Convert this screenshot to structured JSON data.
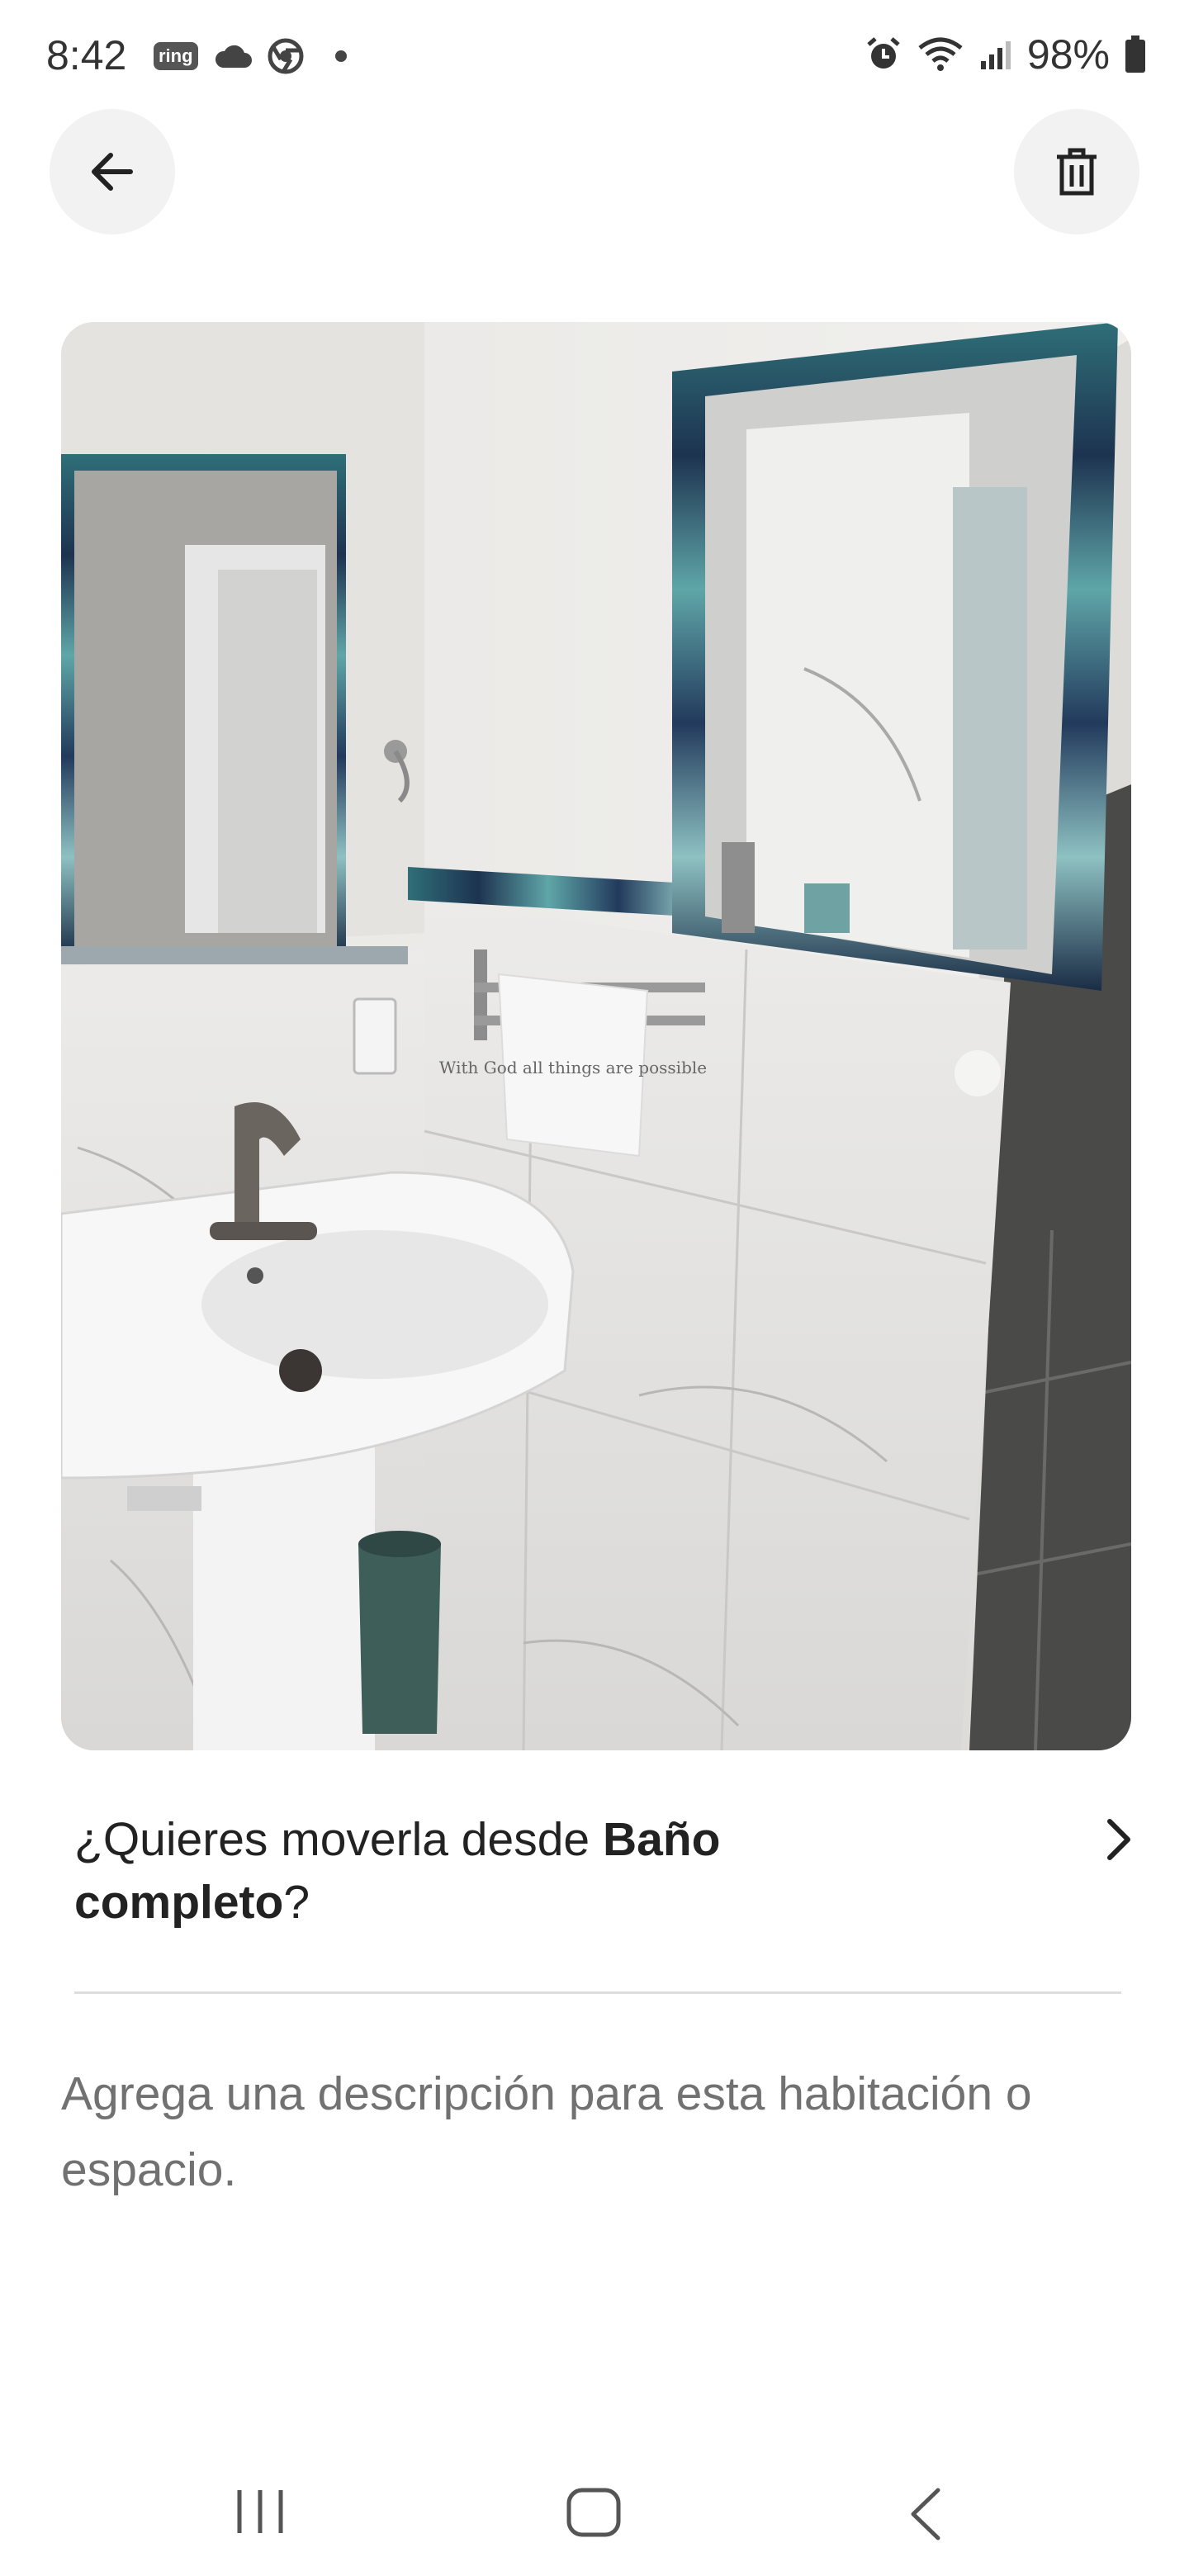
{
  "status": {
    "time": "8:42",
    "ring_label": "ring",
    "battery": "98%"
  },
  "header": {
    "back_icon": "arrow-left-icon",
    "delete_icon": "trash-icon"
  },
  "photo": {
    "towel_text": "With God all things are possible"
  },
  "move_prompt": {
    "prefix": "¿Quieres moverla desde ",
    "room": "Baño completo",
    "suffix": "?"
  },
  "description_placeholder": "Agrega una descripción para esta habitación o espacio.",
  "navbar": {
    "recents_icon": "recents-icon",
    "home_icon": "home-icon",
    "back_icon": "back-icon"
  }
}
